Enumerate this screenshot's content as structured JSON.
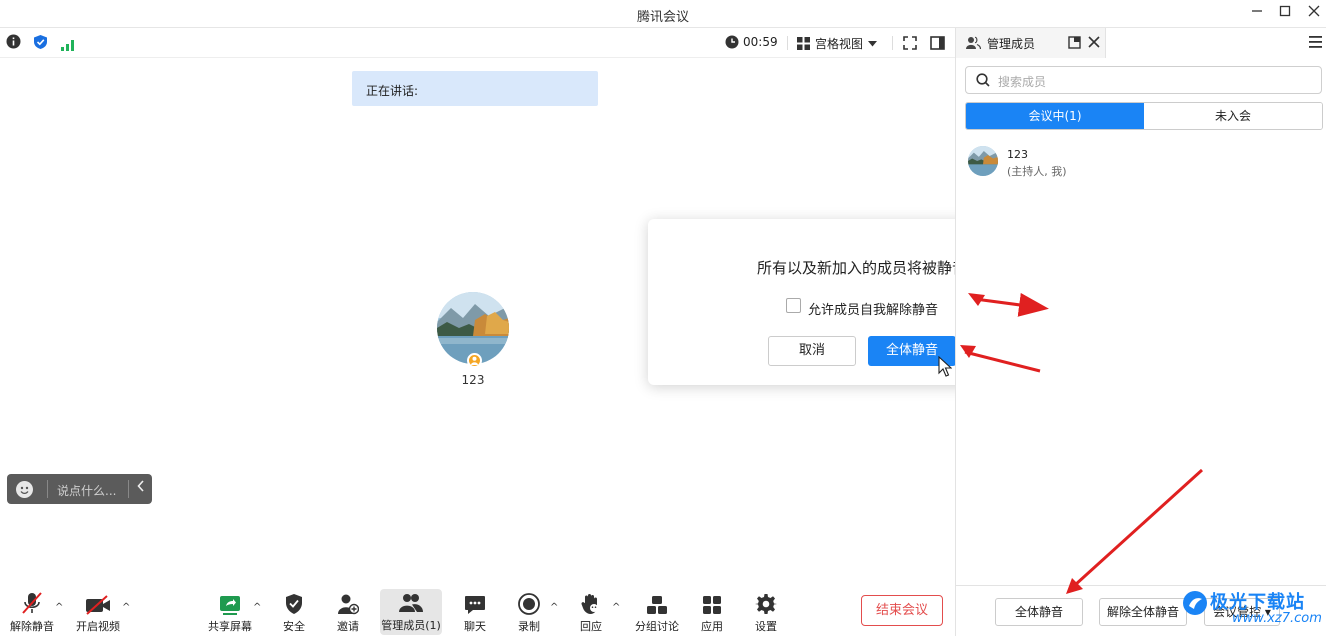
{
  "window": {
    "title": "腾讯会议"
  },
  "topbar": {
    "timer": "00:59",
    "view_label": "宫格视图"
  },
  "stage": {
    "speaking_label": "正在讲话:",
    "participant_name": "123",
    "chat_placeholder": "说点什么..."
  },
  "dialog": {
    "title": "所有以及新加入的成员将被静音",
    "checkbox_label": "允许成员自我解除静音",
    "cancel_label": "取消",
    "confirm_label": "全体静音"
  },
  "panel": {
    "title": "管理成员",
    "search_placeholder": "搜索成员",
    "tabs": [
      {
        "label": "会议中(1)",
        "active": true
      },
      {
        "label": "未入会",
        "active": false
      }
    ],
    "members": [
      {
        "name": "123",
        "role": "(主持人, 我)"
      }
    ],
    "footer": {
      "mute_all": "全体静音",
      "unmute_all": "解除全体静音",
      "manage": "会议管控"
    }
  },
  "toolbar": {
    "items": [
      {
        "label": "解除静音",
        "icon": "mic-muted-icon"
      },
      {
        "label": "开启视频",
        "icon": "video-off-icon"
      },
      {
        "label": "共享屏幕",
        "icon": "share-screen-icon"
      },
      {
        "label": "安全",
        "icon": "shield-icon"
      },
      {
        "label": "邀请",
        "icon": "invite-icon"
      },
      {
        "label": "管理成员(1)",
        "icon": "members-icon"
      },
      {
        "label": "聊天",
        "icon": "chat-icon"
      },
      {
        "label": "录制",
        "icon": "record-icon"
      },
      {
        "label": "回应",
        "icon": "reaction-icon"
      },
      {
        "label": "分组讨论",
        "icon": "breakout-icon"
      },
      {
        "label": "应用",
        "icon": "apps-icon"
      },
      {
        "label": "设置",
        "icon": "gear-icon"
      }
    ],
    "end_label": "结束会议"
  },
  "watermark": {
    "line1": "极光下载站",
    "line2": "www.xz7.com"
  },
  "colors": {
    "accent": "#1a84f5",
    "danger": "#e34d4d",
    "annotation": "#e02020",
    "speaking_bg": "#d9e8fb"
  }
}
